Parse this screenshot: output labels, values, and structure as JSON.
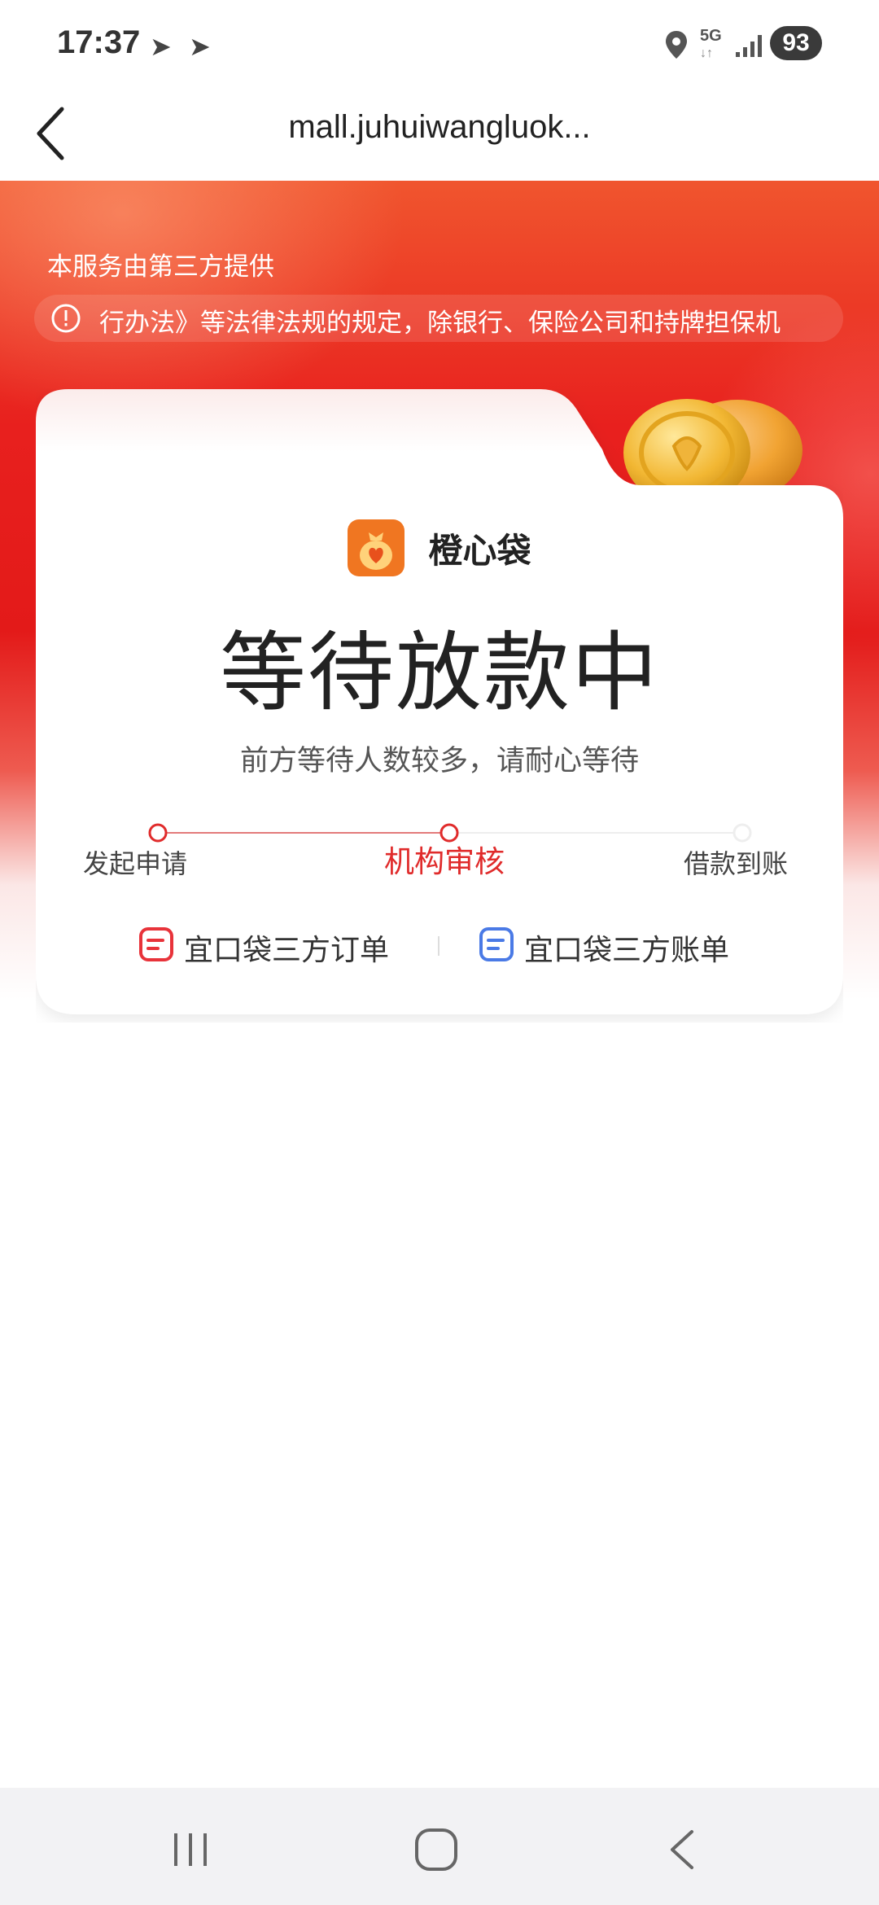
{
  "status_bar": {
    "time": "17:37",
    "network": "5G",
    "battery": "93"
  },
  "nav": {
    "title": "mall.juhuiwangluok..."
  },
  "banner": {
    "provider_text": "本服务由第三方提供",
    "notice_text": "行办法》等法律法规的规定，除银行、保险公司和持牌担保机"
  },
  "card": {
    "brand_name": "橙心袋",
    "headline": "等待放款中",
    "subtext": "前方等待人数较多，请耐心等待",
    "steps": [
      {
        "label": "发起申请",
        "state": "done"
      },
      {
        "label": "机构审核",
        "state": "current"
      },
      {
        "label": "借款到账",
        "state": "pending"
      }
    ],
    "links": [
      {
        "label": "宜口袋三方订单",
        "color": "#e8333a"
      },
      {
        "label": "宜口袋三方账单",
        "color": "#4a7ae6"
      }
    ]
  },
  "colors": {
    "brand_red": "#e31a19",
    "accent_red": "#e02b2b",
    "logo_orange": "#f07621"
  }
}
